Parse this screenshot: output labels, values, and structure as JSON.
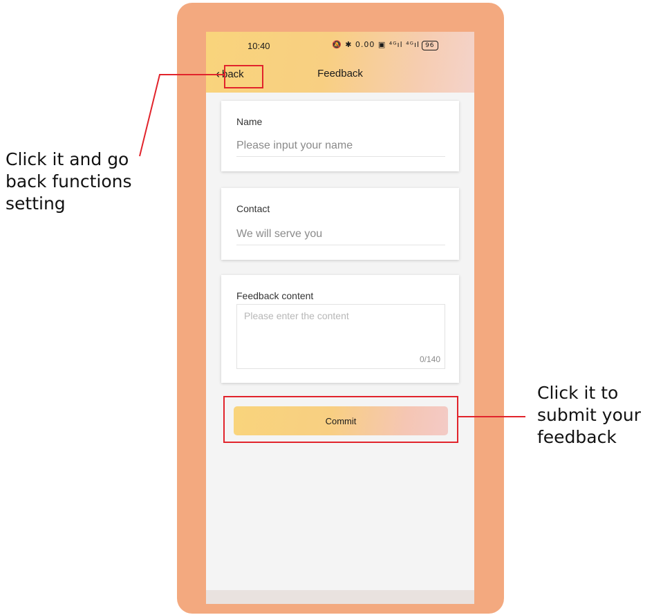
{
  "status_bar": {
    "time": "10:40",
    "icons_text": "🔕 ✱ 0.00 ▣ ⁴ᴳıl ⁴ᴳıl",
    "battery": "96"
  },
  "header": {
    "back_label": "back",
    "back_icon": "chevron-left-icon",
    "title": "Feedback"
  },
  "form": {
    "name": {
      "label": "Name",
      "placeholder": "Please input your name"
    },
    "contact": {
      "label": "Contact",
      "placeholder": "We will serve you"
    },
    "feedback": {
      "label": "Feedback content",
      "placeholder": "Please enter the content",
      "counter": "0/140"
    },
    "commit_label": "Commit"
  },
  "annotations": {
    "back_note": [
      "Click it and go",
      "back functions",
      "setting"
    ],
    "commit_note": [
      "Click it to",
      "submit your",
      "feedback"
    ],
    "highlight_color": "#e1232b"
  },
  "colors": {
    "frame": "#f3a97f",
    "header_gradient_start": "#f9d47c",
    "header_gradient_end": "#f4d3cb"
  }
}
